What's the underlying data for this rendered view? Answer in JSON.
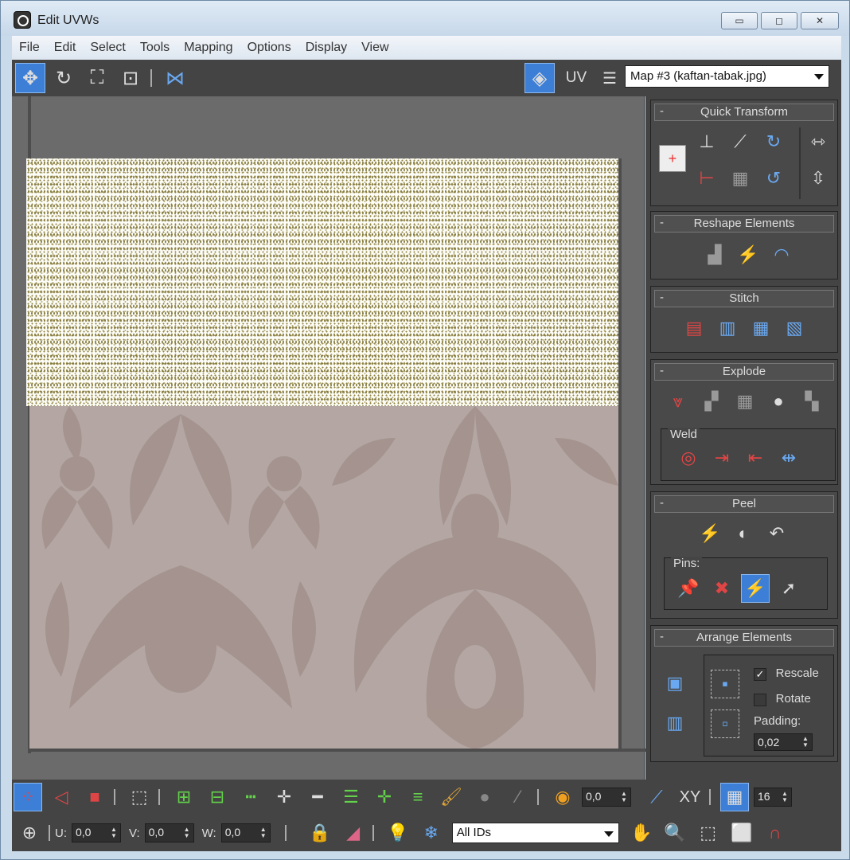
{
  "window": {
    "title": "Edit UVWs",
    "minimize_glyph": "▭",
    "maximize_glyph": "◻",
    "close_glyph": "✕"
  },
  "menu": [
    "File",
    "Edit",
    "Select",
    "Tools",
    "Mapping",
    "Options",
    "Display",
    "View"
  ],
  "toolbar": {
    "uv_label": "UV",
    "map_select": "Map #3 (kaftan-tabak.jpg)"
  },
  "rollouts": {
    "quick_transform": "Quick Transform",
    "reshape_elements": "Reshape Elements",
    "stitch": "Stitch",
    "explode": "Explode",
    "weld": "Weld",
    "peel": "Peel",
    "pins": "Pins:",
    "arrange_elements": "Arrange Elements",
    "rescale": "Rescale",
    "rotate": "Rotate",
    "padding_label": "Padding:",
    "padding_value": "0,02",
    "rescale_checked": true,
    "rotate_checked": false
  },
  "bottom": {
    "soft_value": "0,0",
    "xy_label": "XY",
    "grid_value": "16",
    "u_label": "U:",
    "u_value": "0,0",
    "v_label": "V:",
    "v_value": "0,0",
    "w_label": "W:",
    "w_value": "0,0",
    "ids_select": "All IDs"
  },
  "colors": {
    "accent": "#3d7fd6",
    "panel": "#444444",
    "noise_bg": "#fdfdf8",
    "damask_bg": "#b3a6a3",
    "damask_pattern": "#a3918c"
  }
}
